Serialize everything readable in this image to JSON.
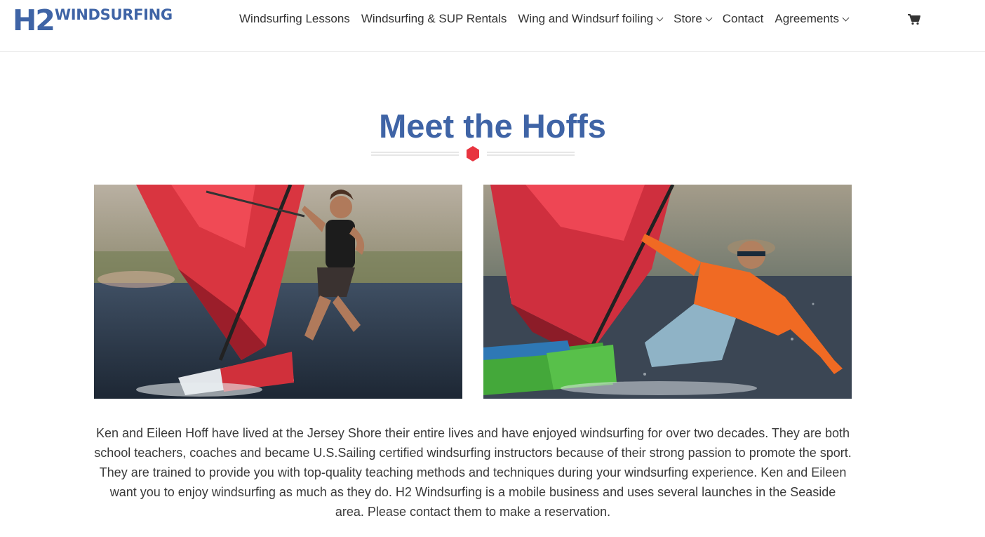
{
  "brand": {
    "logo_h2": "H2",
    "logo_word": "WINDSURFING",
    "color": "#3f64a6"
  },
  "nav": {
    "items": [
      {
        "label": "Windsurfing Lessons",
        "dropdown": false
      },
      {
        "label": "Windsurfing & SUP Rentals",
        "dropdown": false
      },
      {
        "label": "Wing and Windsurf foiling",
        "dropdown": true
      },
      {
        "label": "Store",
        "dropdown": true
      },
      {
        "label": "Contact",
        "dropdown": false
      },
      {
        "label": "Agreements",
        "dropdown": true
      }
    ],
    "cart_icon": "shopping-cart-icon"
  },
  "main": {
    "title": "Meet the Hoffs",
    "accent_color": "#e8343f",
    "photos": [
      {
        "subject": "eileen-windsurfing-photo"
      },
      {
        "subject": "ken-windsurfing-photo"
      }
    ],
    "bio": "Ken and Eileen Hoff have lived at the Jersey Shore their entire lives and have enjoyed windsurfing for over two decades. They are both school teachers, coaches and became U.S.Sailing certified windsurfing instructors because of their strong passion to promote the sport. They are trained to provide you with top-quality teaching methods and techniques during your windsurfing experience. Ken and Eileen want you to enjoy windsurfing as much as they do. H2 Windsurfing is a mobile business and uses several launches in the Seaside area. Please contact them to make a reservation."
  }
}
